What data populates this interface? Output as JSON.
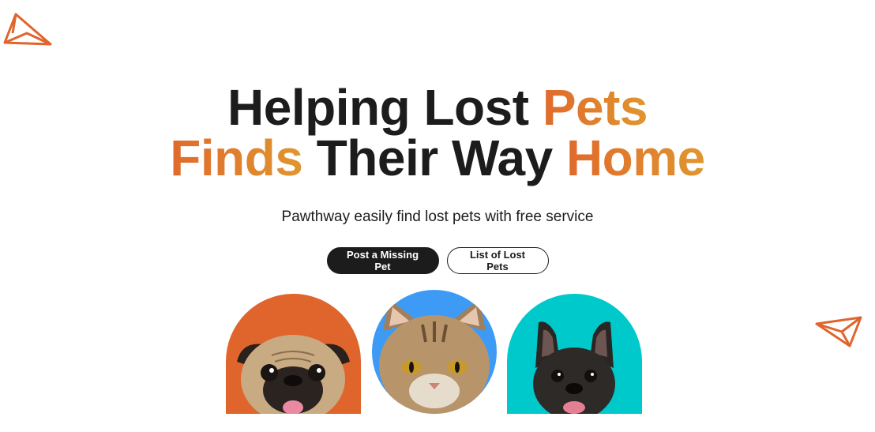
{
  "hero": {
    "title_line1_dark": "Helping Lost ",
    "title_line1_accent": "Pets",
    "title_line2_accent_a": "Finds",
    "title_line2_dark": " Their Way ",
    "title_line2_accent_b": "Home",
    "subtitle": "Pawthway easily find lost pets with free service"
  },
  "actions": {
    "post_missing": "Post a Missing Pet",
    "list_lost": "List of Lost Pets"
  },
  "colors": {
    "accent_start": "#e06a2c",
    "accent_end": "#e0962f",
    "dark": "#1c1c1c",
    "dog_bg": "#e0652c",
    "cat_bg": "#3d9bf5",
    "bulldog_bg": "#00c9cc"
  },
  "icons": [
    "paper-plane-icon",
    "paper-plane-icon"
  ],
  "pets": [
    {
      "kind": "pug",
      "icon": "pug-photo"
    },
    {
      "kind": "cat",
      "icon": "cat-photo"
    },
    {
      "kind": "french-bulldog",
      "icon": "french-bulldog-photo"
    }
  ]
}
